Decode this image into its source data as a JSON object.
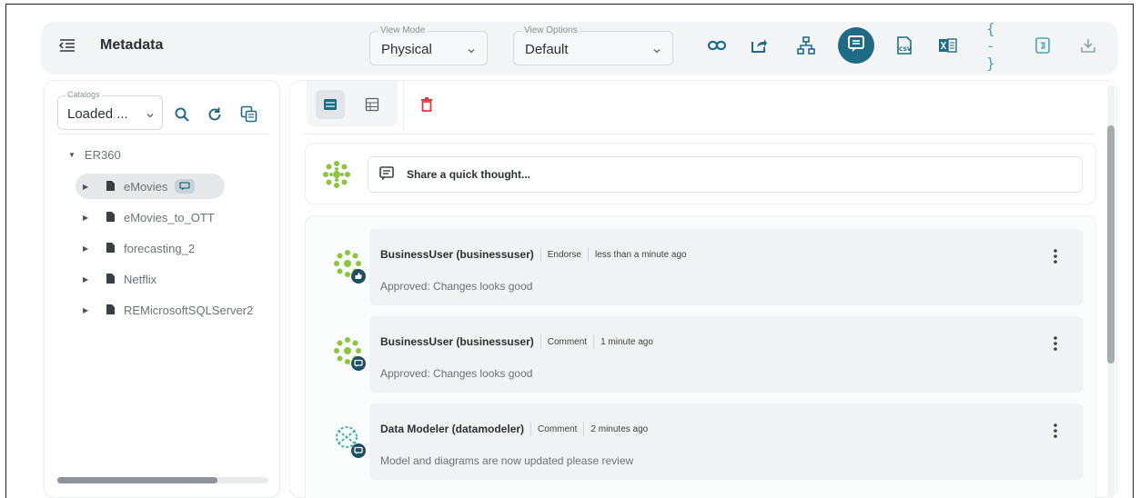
{
  "header": {
    "title": "Metadata",
    "view_mode": {
      "legend": "View Mode",
      "value": "Physical"
    },
    "view_options": {
      "legend": "View Options",
      "value": "Default"
    },
    "toolbar_icons": [
      "link-icon",
      "share-icon",
      "hierarchy-icon",
      "comments-icon",
      "csv-export-icon",
      "excel-export-icon",
      "json-icon",
      "document-icon",
      "download-icon"
    ],
    "csv_text": "CSV",
    "json_text": "{ - }"
  },
  "catalog": {
    "legend": "Catalogs",
    "value": "Loaded ..."
  },
  "tree": {
    "root": "ER360",
    "items": [
      {
        "label": "eMovies",
        "selected": true
      },
      {
        "label": "eMovies_to_OTT",
        "selected": false
      },
      {
        "label": "forecasting_2",
        "selected": false
      },
      {
        "label": "Netflix",
        "selected": false
      },
      {
        "label": "REMicrosoftSQLServer2",
        "selected": false
      }
    ]
  },
  "compose": {
    "placeholder": "Share a quick thought..."
  },
  "comments": [
    {
      "user": "BusinessUser (businessuser)",
      "type": "Endorse",
      "time": "less than a minute ago",
      "body": "Approved: Changes looks good",
      "badge": "thumbs-up-icon"
    },
    {
      "user": "BusinessUser (businessuser)",
      "type": "Comment",
      "time": "1 minute ago",
      "body": "Approved: Changes looks good",
      "badge": "comment-icon"
    },
    {
      "user": "Data Modeler (datamodeler)",
      "type": "Comment",
      "time": "2 minutes ago",
      "body": "Model and diagrams are now updated please review",
      "badge": "comment-icon"
    }
  ],
  "colors": {
    "accent": "#1e6b83",
    "delete": "#e0393e",
    "avatar_green": "#8cc63f",
    "avatar_teal": "#2bb5a0"
  }
}
